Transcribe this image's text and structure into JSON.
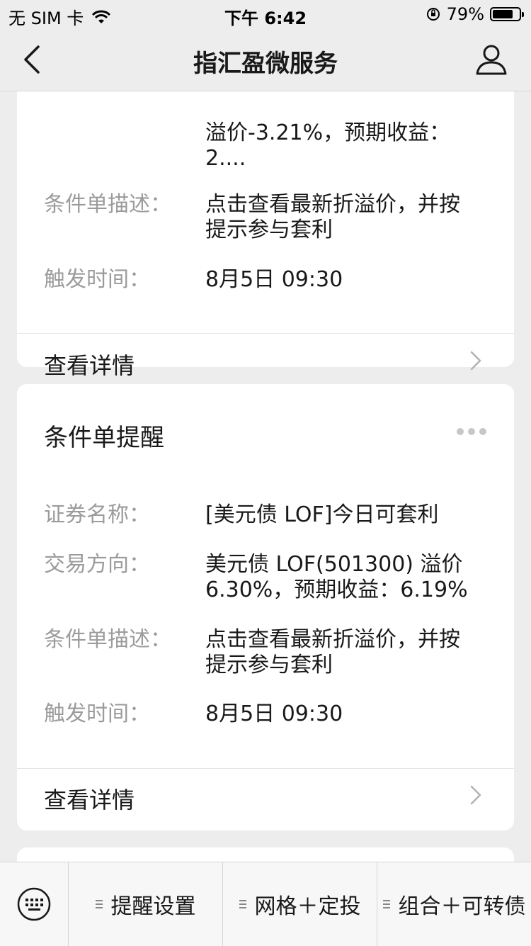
{
  "status_bar": {
    "carrier": "无 SIM 卡",
    "time": "下午 6:42",
    "battery": "79%",
    "battery_level": 0.79
  },
  "nav": {
    "title": "指汇盈微服务",
    "back_icon": "chevron-left-icon",
    "profile_icon": "person-icon"
  },
  "card1": {
    "partial_value_line1": "溢价-3.21%，预期收益：",
    "partial_value_line2": "2....",
    "rows": [
      {
        "label": "条件单描述：",
        "value_line1": "点击查看最新折溢价，并按",
        "value_line2": "提示参与套利"
      },
      {
        "label": "触发时间：",
        "value": "8月5日 09:30"
      }
    ],
    "detail_label": "查看详情"
  },
  "card2": {
    "title": "条件单提醒",
    "rows": [
      {
        "label": "证券名称：",
        "value": "[美元债 LOF]今日可套利"
      },
      {
        "label": "交易方向：",
        "value_line1": "美元债 LOF(501300) 溢价",
        "value_line2": "6.30%，预期收益：6.19%"
      },
      {
        "label": "条件单描述：",
        "value_line1": "点击查看最新折溢价，并按",
        "value_line2": "提示参与套利"
      },
      {
        "label": "触发时间：",
        "value": "8月5日 09:30"
      }
    ],
    "detail_label": "查看详情"
  },
  "bottom_menu": {
    "keyboard_icon": "keyboard-icon",
    "items": [
      {
        "label": "提醒设置"
      },
      {
        "label": "网格＋定投"
      },
      {
        "label": "组合＋可转债"
      }
    ]
  },
  "colors": {
    "background": "#ededed",
    "card": "#ffffff",
    "label": "#9b9b9b",
    "text": "#191919"
  }
}
